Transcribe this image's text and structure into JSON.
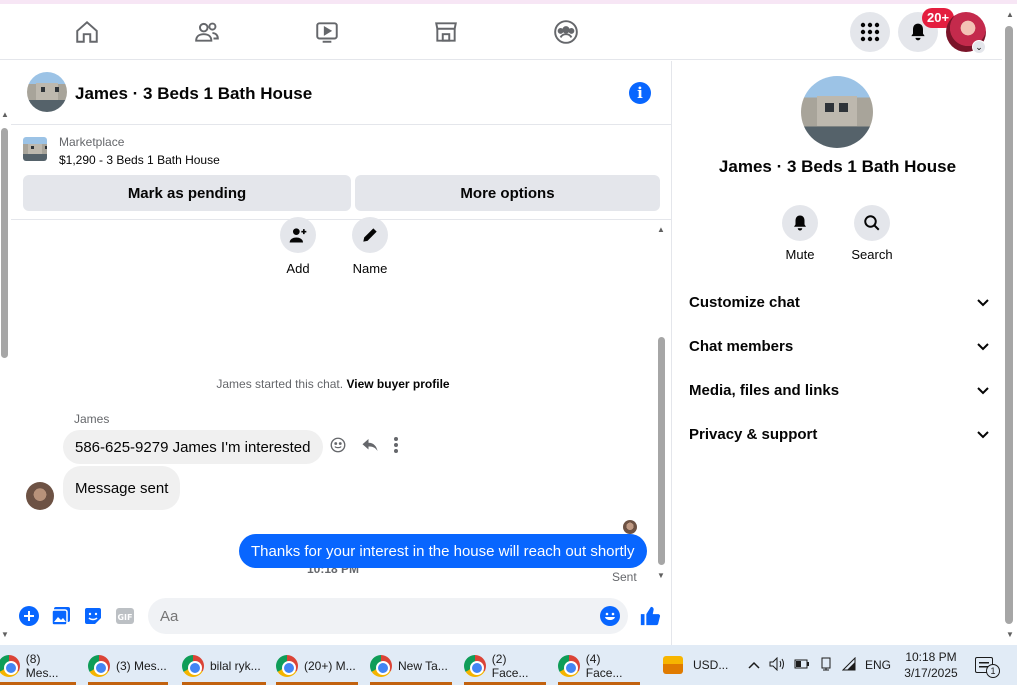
{
  "nav": {
    "notification_count": "20+"
  },
  "chat": {
    "title": "James · 3 Beds 1 Bath House",
    "marketplace": {
      "label": "Marketplace",
      "listing": "$1,290 - 3 Beds 1 Bath House",
      "mark_pending": "Mark as pending",
      "more_options": "More options"
    },
    "actions": {
      "add": "Add",
      "name": "Name"
    },
    "system_text": "James started this chat.",
    "system_link": "View buyer profile",
    "sender_name": "James",
    "incoming": [
      "586-625-9279 James I'm interested",
      "Message sent"
    ],
    "timestamp": "10:18 PM",
    "outgoing": "Thanks for your interest in the house will reach out shortly",
    "status": "Sent",
    "composer_placeholder": "Aa"
  },
  "panel": {
    "title": "James · 3 Beds 1 Bath House",
    "mute": "Mute",
    "search": "Search",
    "sections": [
      "Customize chat",
      "Chat members",
      "Media, files and links",
      "Privacy & support"
    ]
  },
  "taskbar": {
    "tasks": [
      "(8) Mes...",
      "(3) Mes...",
      "bilal ryk...",
      "(20+) M...",
      "New Ta...",
      "(2) Face...",
      "(4) Face..."
    ],
    "currency": "USD...",
    "lang": "ENG",
    "time": "10:18 PM",
    "date": "3/17/2025",
    "notif": "1"
  },
  "colors": {
    "accent": "#0866ff",
    "badge": "#e41e3f"
  }
}
